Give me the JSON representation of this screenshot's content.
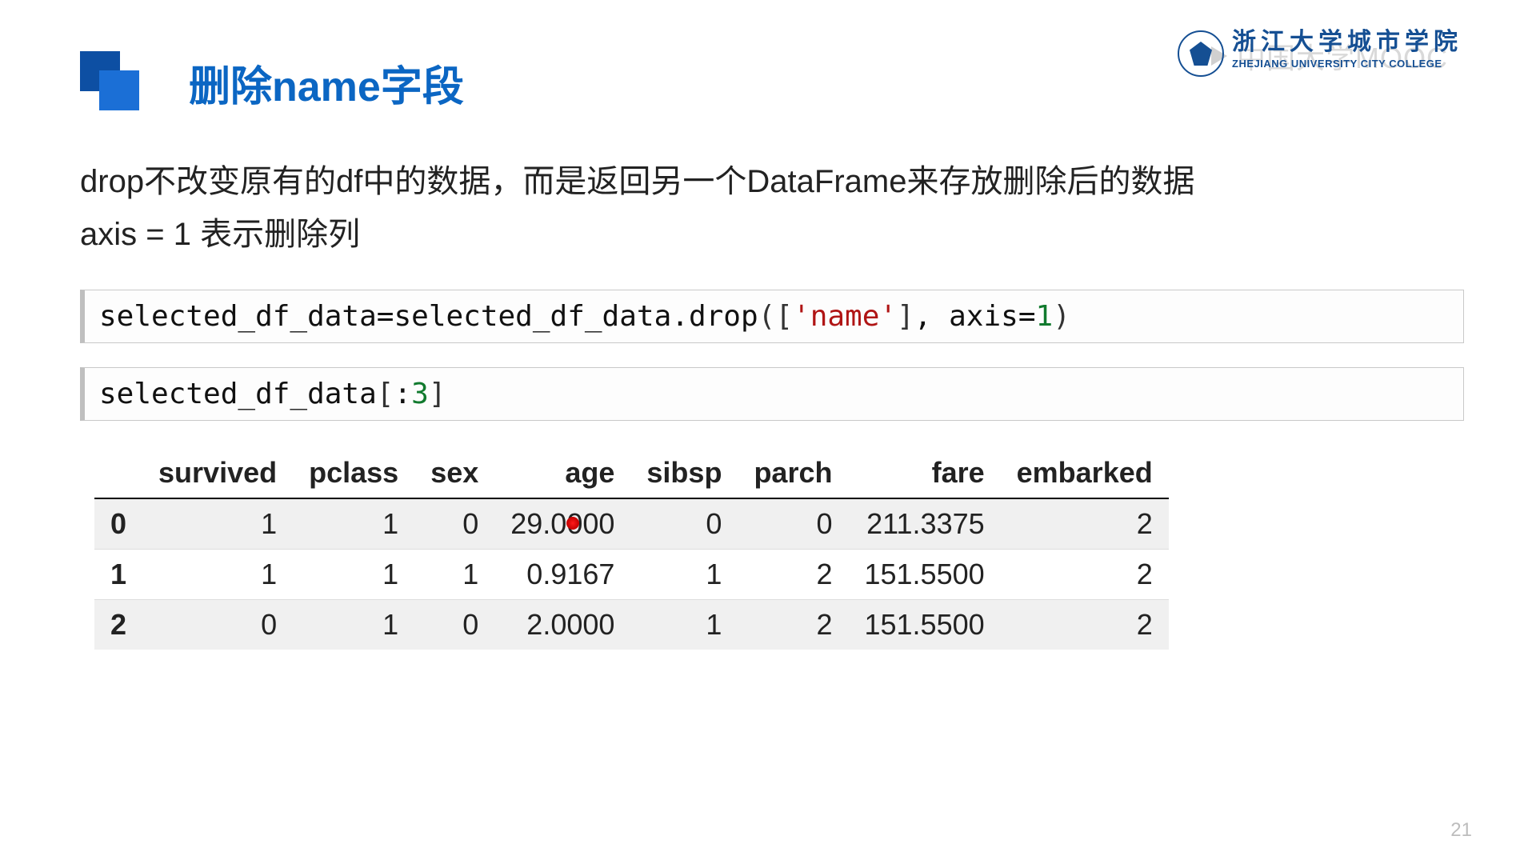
{
  "watermark": "中国大学MOOC",
  "logo": {
    "cn": "浙江大学城市学院",
    "en": "ZHEJIANG UNIVERSITY CITY COLLEGE"
  },
  "title": "删除name字段",
  "body_line1": "drop不改变原有的df中的数据，而是返回另一个DataFrame来存放删除后的数据",
  "body_line2": "axis = 1 表示删除列",
  "code1": {
    "lhs": "selected_df_data",
    "assign": "=",
    "rhs_obj": "selected_df_data",
    "dot": ".",
    "method": "drop",
    "lpar": "(",
    "lbrk": "[",
    "str": "'name'",
    "rbrk": "]",
    "comma": ", ",
    "kwarg": "axis",
    "eq": "=",
    "num": "1",
    "rpar": ")"
  },
  "code2": {
    "obj": "selected_df_data",
    "lbrk": "[",
    "colon": ":",
    "num": "3",
    "rbrk": "]"
  },
  "table": {
    "headers": [
      "",
      "survived",
      "pclass",
      "sex",
      "age",
      "sibsp",
      "parch",
      "fare",
      "embarked"
    ],
    "rows": [
      {
        "idx": "0",
        "cells": [
          "1",
          "1",
          "0",
          "29.0000",
          "0",
          "0",
          "211.3375",
          "2"
        ]
      },
      {
        "idx": "1",
        "cells": [
          "1",
          "1",
          "1",
          "0.9167",
          "1",
          "2",
          "151.5500",
          "2"
        ]
      },
      {
        "idx": "2",
        "cells": [
          "0",
          "1",
          "0",
          "2.0000",
          "1",
          "2",
          "151.5500",
          "2"
        ]
      }
    ]
  },
  "page_number": "21"
}
